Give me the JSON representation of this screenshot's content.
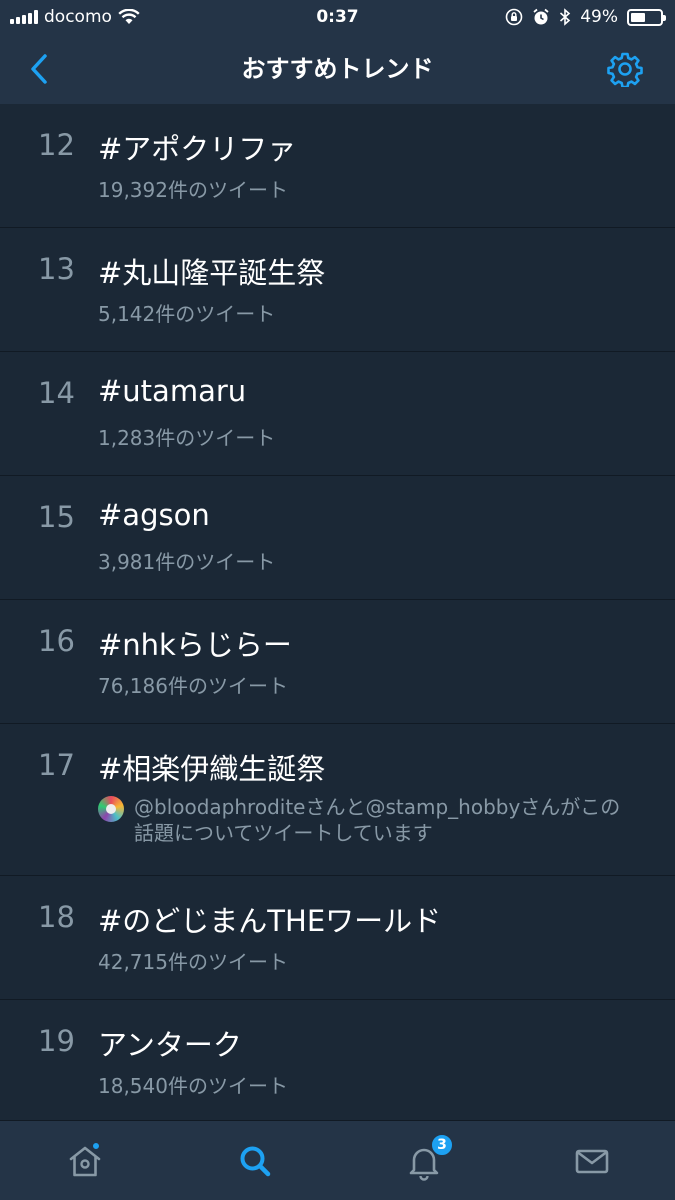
{
  "status_bar": {
    "carrier": "docomo",
    "time": "0:37",
    "battery_percent": "49%",
    "battery_level": 0.49
  },
  "nav": {
    "title": "おすすめトレンド",
    "back_icon": "chevron-left-icon",
    "settings_icon": "gear-icon"
  },
  "trends": [
    {
      "rank": "12",
      "name": "#アポクリファ",
      "meta": "19,392件のツイート"
    },
    {
      "rank": "13",
      "name": "#丸山隆平誕生祭",
      "meta": "5,142件のツイート"
    },
    {
      "rank": "14",
      "name": "#utamaru",
      "meta": "1,283件のツイート"
    },
    {
      "rank": "15",
      "name": "#agson",
      "meta": "3,981件のツイート"
    },
    {
      "rank": "16",
      "name": "#nhkらじらー",
      "meta": "76,186件のツイート"
    },
    {
      "rank": "17",
      "name": "#相楽伊織生誕祭",
      "context": "@bloodaphroditeさんと@stamp_hobbyさんがこの話題についてツイートしています"
    },
    {
      "rank": "18",
      "name": "#のどじまんTHEワールド",
      "meta": "42,715件のツイート"
    },
    {
      "rank": "19",
      "name": "アンターク",
      "meta": "18,540件のツイート"
    }
  ],
  "tab_bar": {
    "notifications_badge": "3",
    "accent_color": "#1da1f2",
    "inactive_color": "#8899a6"
  }
}
